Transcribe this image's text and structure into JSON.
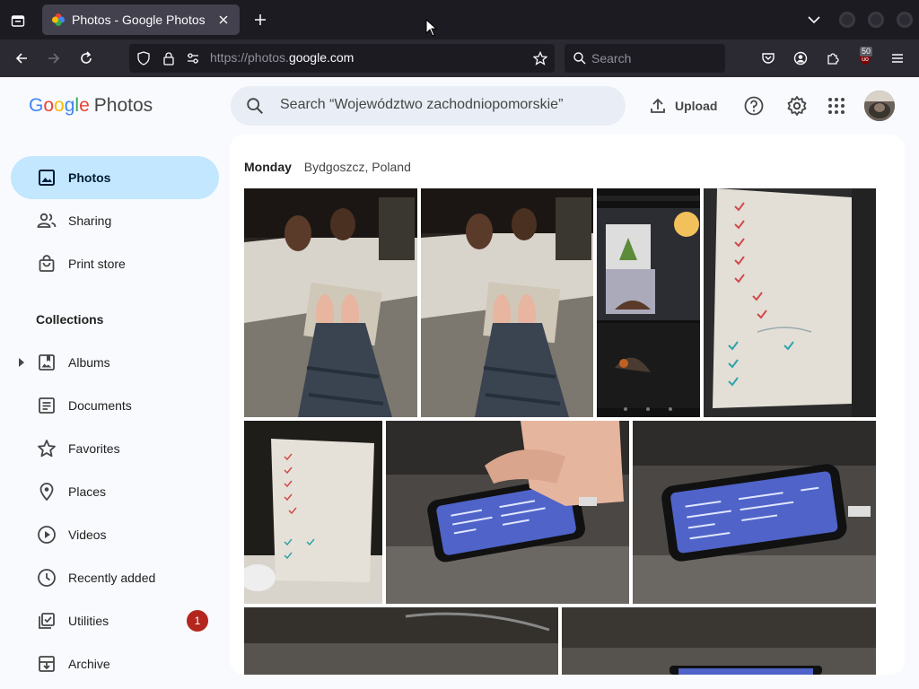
{
  "browser": {
    "tab_title": "Photos - Google Photos",
    "url_scheme": "https://photos.",
    "url_domain": "google.com",
    "search_placeholder": "Search",
    "ublock_count": "50"
  },
  "app": {
    "logo_google": [
      "G",
      "o",
      "o",
      "g",
      "l",
      "e"
    ],
    "logo_product": "Photos",
    "search_placeholder": "Search “Województwo zachodniopomorskie”",
    "upload_label": "Upload",
    "accent_color": "#c2e7ff"
  },
  "sidebar": {
    "items": [
      {
        "label": "Photos",
        "icon": "photo-icon",
        "active": true
      },
      {
        "label": "Sharing",
        "icon": "people-icon"
      },
      {
        "label": "Print store",
        "icon": "shopping-bag-icon"
      }
    ],
    "collections_title": "Collections",
    "collections": [
      {
        "label": "Albums",
        "icon": "album-icon",
        "expandable": true
      },
      {
        "label": "Documents",
        "icon": "document-icon"
      },
      {
        "label": "Favorites",
        "icon": "star-icon"
      },
      {
        "label": "Places",
        "icon": "place-icon"
      },
      {
        "label": "Videos",
        "icon": "play-icon"
      },
      {
        "label": "Recently added",
        "icon": "clock-icon"
      },
      {
        "label": "Utilities",
        "icon": "utilities-icon",
        "badge": "1"
      },
      {
        "label": "Archive",
        "icon": "archive-icon"
      }
    ]
  },
  "main": {
    "day": "Monday",
    "location": "Bydgoszcz, Poland"
  }
}
